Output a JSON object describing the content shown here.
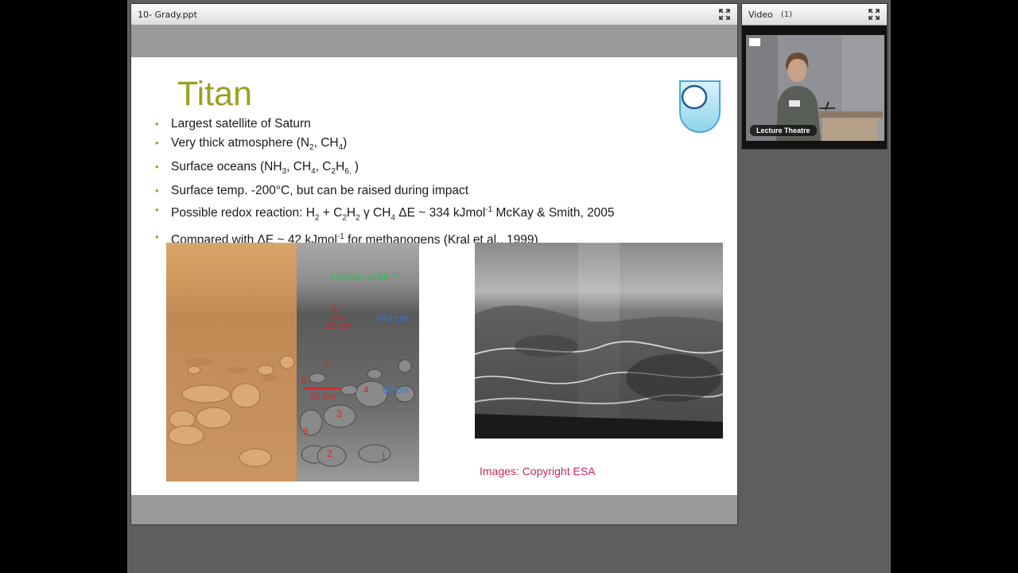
{
  "share_pod": {
    "title": "10- Grady.ppt"
  },
  "video_pod": {
    "title": "Video",
    "count": "(1)",
    "label": "Lecture  Theatre"
  },
  "slide": {
    "title": "Titan",
    "bullets": {
      "b1": "Largest satellite of Saturn",
      "b2_a": "Very thick atmosphere (N",
      "b2_s1": "2",
      "b2_b": ", CH",
      "b2_s2": "4",
      "b2_c": ")",
      "b3_a": "Surface oceans (NH",
      "b3_s1": "3",
      "b3_b": ", CH",
      "b3_s2": "4",
      "b3_c": ", C",
      "b3_s3": "2",
      "b3_d": "H",
      "b3_s4": "6,",
      "b3_e": " )",
      "b4": "Surface temp. -200°C, but can be raised during impact",
      "b5_a": "Possible redox reaction: H",
      "b5_s1": "2",
      "b5_b": " + C",
      "b5_s2": "2",
      "b5_c": "H",
      "b5_s3": "2",
      "b5_d": " γ CH",
      "b5_s4": "4",
      "b5_e": " ΔE ~ 334 kJmol",
      "b5_sup": "-1",
      "b5_f": " McKay & Smith, 2005",
      "b6_a": "Compared with ΔE ~ 42 kJmol",
      "b6_sup": "-1",
      "b6_b": " for  methanogens (Kral et al., 1999)"
    },
    "annotations": {
      "horizon": "Horizon at 56.7°",
      "a6": "6",
      "a15cm": "15 cm",
      "a240": "240 cm",
      "a7": "7",
      "a5": "5",
      "a4": "4",
      "a85": "85 cm",
      "a10": "10 cm",
      "a3": "3",
      "a8": "8",
      "a2": "2",
      "a1": "1"
    },
    "copyright": "Images: Copyright ESA"
  }
}
